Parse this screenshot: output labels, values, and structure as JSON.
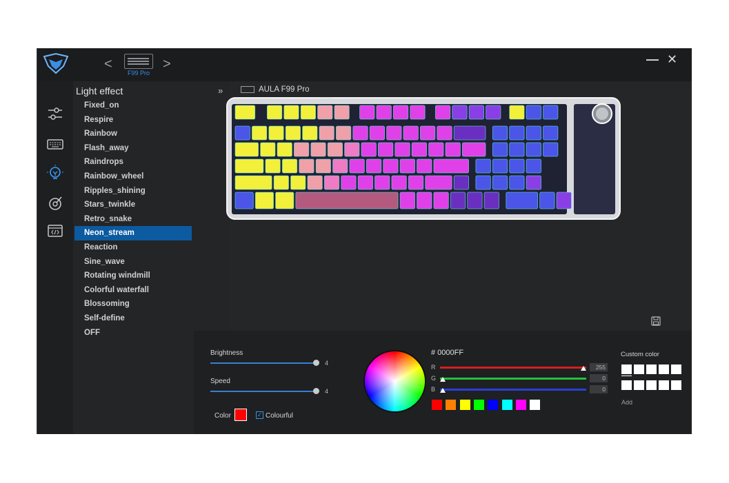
{
  "device": {
    "model_short": "F99 Pro",
    "full_name": "AULA F99 Pro"
  },
  "window": {
    "minimize_glyph": "—",
    "close_glyph": "✕",
    "prev_glyph": "<",
    "next_glyph": ">"
  },
  "sidebar_icons": [
    "sliders-icon",
    "keyboard-icon",
    "lightbulb-icon",
    "macro-icon",
    "firmware-icon"
  ],
  "effects": {
    "title": "Light effect",
    "collapse_glyph": "»",
    "items": [
      "Fixed_on",
      "Respire",
      "Rainbow",
      "Flash_away",
      "Raindrops",
      "Rainbow_wheel",
      "Ripples_shining",
      "Stars_twinkle",
      "Retro_snake",
      "Neon_stream",
      "Reaction",
      "Sine_wave",
      "Rotating windmill",
      "Colorful waterfall",
      "Blossoming",
      "Self-define",
      "OFF"
    ],
    "selected": "Neon_stream"
  },
  "controls": {
    "brightness": {
      "label": "Brightness",
      "value": "4",
      "level": 1.0
    },
    "speed": {
      "label": "Speed",
      "value": "4",
      "level": 1.0
    },
    "color_label": "Color",
    "color_value": "#FF0000",
    "colourful_label": "Colourful",
    "colourful_checked": true
  },
  "picker": {
    "hex": "# 0000FF",
    "r": {
      "label": "R",
      "value": "255"
    },
    "g": {
      "label": "G",
      "value": "0"
    },
    "b": {
      "label": "B",
      "value": "0"
    },
    "presets": [
      "#ff0000",
      "#ff8000",
      "#ffff00",
      "#00ff00",
      "#0000ff",
      "#00ffff",
      "#ff00ff",
      "#ffffff"
    ]
  },
  "custom": {
    "title": "Custom color",
    "add_label": "Add"
  },
  "key_colors": {
    "yellow": "#f2f03a",
    "pink": "#ee7bc4",
    "magenta": "#e040e8",
    "purple": "#8a3fe6",
    "blue": "#4b55e8",
    "peach": "#f0a0a8",
    "violet": "#6a2fc0"
  }
}
